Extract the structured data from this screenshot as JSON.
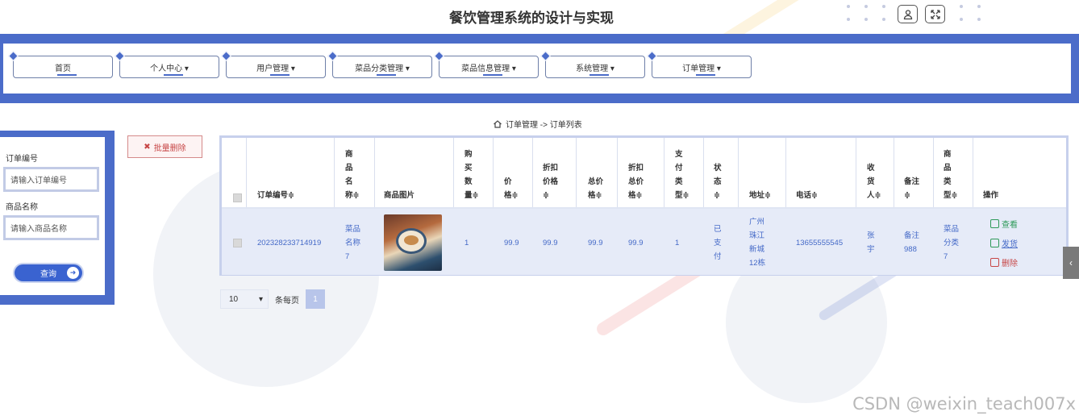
{
  "header": {
    "title": "餐饮管理系统的设计与实现",
    "user_icon": "user-icon",
    "fullscreen_icon": "fullscreen-icon"
  },
  "nav": {
    "items": [
      {
        "label": "首页"
      },
      {
        "label": "个人中心 ▾"
      },
      {
        "label": "用户管理 ▾"
      },
      {
        "label": "菜品分类管理 ▾"
      },
      {
        "label": "菜品信息管理 ▾"
      },
      {
        "label": "系统管理 ▾"
      },
      {
        "label": "订单管理 ▾"
      }
    ]
  },
  "search": {
    "order_no_label": "订单编号",
    "order_no_placeholder": "请输入订单编号",
    "product_label": "商品名称",
    "product_placeholder": "请输入商品名称",
    "query_label": "查询"
  },
  "actions": {
    "batch_delete_label": "批量删除"
  },
  "breadcrumb": {
    "text": "订单管理 -> 订单列表"
  },
  "table": {
    "columns": [
      "订单编号≑",
      "商\n品\n名\n称≑",
      "商品图片",
      "购\n买\n数\n量≑",
      "价\n格≑",
      "折扣\n价格\n≑",
      "总价\n格≑",
      "折扣\n总价\n格≑",
      "支\n付\n类\n型≑",
      "状\n态\n≑",
      "地址≑",
      "电话≑",
      "收\n货\n人≑",
      "备注\n≑",
      "商\n品\n类\n型≑",
      "操作"
    ],
    "rows": [
      {
        "order_no": "202328233714919",
        "product_name": "菜品\n名称\n7",
        "quantity": "1",
        "price": "99.9",
        "discount_price": "99.9",
        "total": "99.9",
        "discount_total": "99.9",
        "pay_type": "1",
        "status": "已\n支\n付",
        "address": "广州\n珠江\n新城\n12栋",
        "phone": "13655555545",
        "receiver": "张\n宇",
        "remark": "备注\n988",
        "category": "菜品\n分类\n7"
      }
    ],
    "ops": {
      "view_label": "查看",
      "ship_label": "发货",
      "delete_label": "删除"
    }
  },
  "pagination": {
    "page_size": "10",
    "per_page_label": "条每页",
    "current_page": "1"
  },
  "watermark": "CSDN @weixin_teach007x",
  "colors": {
    "primary": "#4b6cc9",
    "link": "#4469c7",
    "danger": "#c74646",
    "success": "#2f9a5a"
  }
}
